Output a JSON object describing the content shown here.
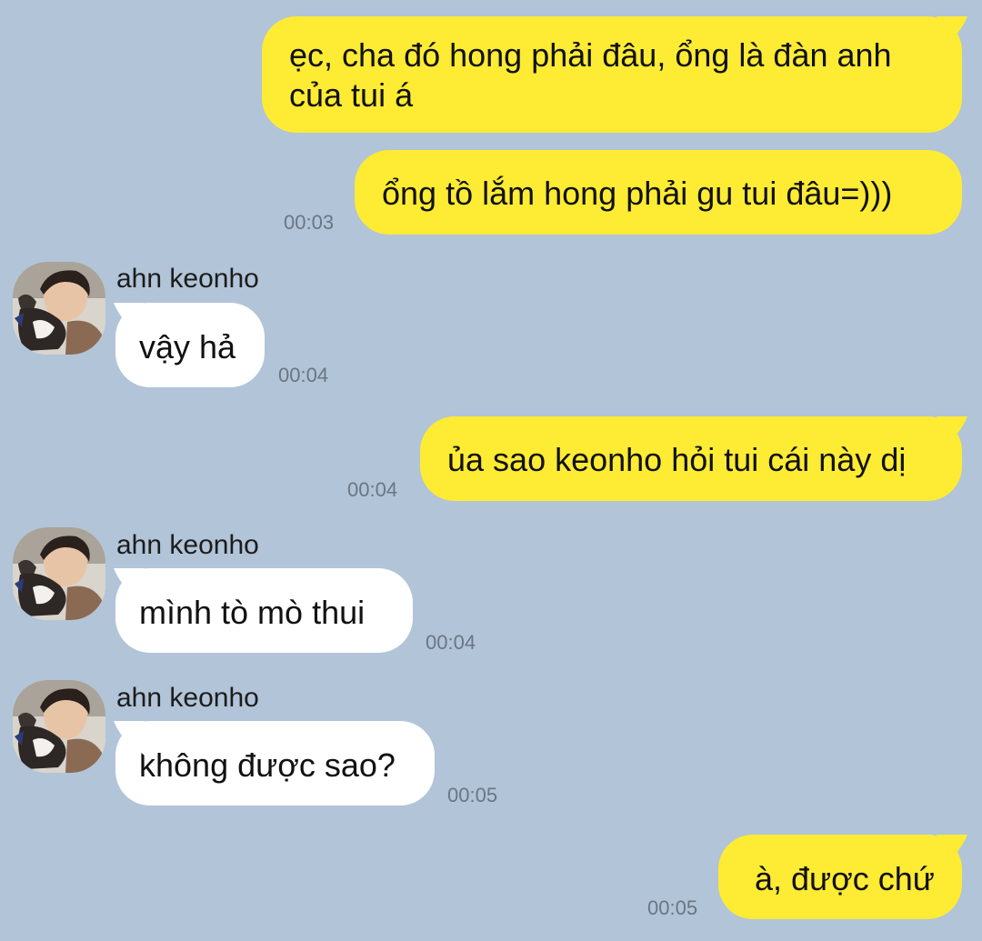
{
  "colors": {
    "background": "#b1c4d8",
    "outgoing_bubble": "#feeb34",
    "incoming_bubble": "#ffffff",
    "timestamp": "#6b7684"
  },
  "contact": {
    "name": "ahn keonho",
    "avatar_icon": "profile-photo-avatar"
  },
  "messages": [
    {
      "direction": "outgoing",
      "lines": [
        "ẹc, cha đó hong phải đâu, ổng là đàn anh",
        "của tui á"
      ],
      "time": ""
    },
    {
      "direction": "outgoing",
      "lines": [
        "ổng tồ lắm hong phải gu tui đâu=)))"
      ],
      "time": "00:03"
    },
    {
      "direction": "incoming",
      "sender": "ahn keonho",
      "lines": [
        "vậy hả"
      ],
      "time": "00:04"
    },
    {
      "direction": "outgoing",
      "lines": [
        "ủa sao keonho hỏi tui cái này dị"
      ],
      "time": "00:04"
    },
    {
      "direction": "incoming",
      "sender": "ahn keonho",
      "lines": [
        "mình tò mò thui"
      ],
      "time": "00:04"
    },
    {
      "direction": "incoming",
      "sender": "ahn keonho",
      "lines": [
        "không được sao?"
      ],
      "time": "00:05"
    },
    {
      "direction": "outgoing",
      "lines": [
        "à, được chứ"
      ],
      "time": "00:05"
    }
  ]
}
